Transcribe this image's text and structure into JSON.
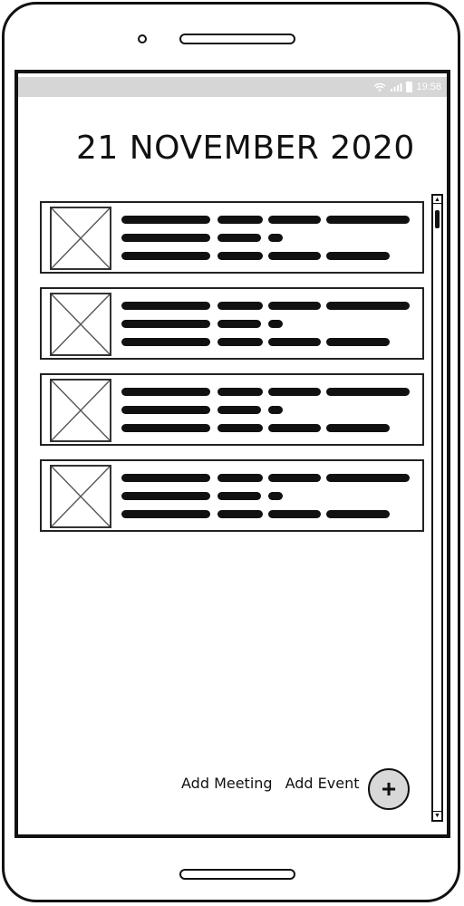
{
  "status_bar": {
    "time": "19:58",
    "wifi_icon": "wifi-icon",
    "signal_icon": "signal-icon",
    "battery_icon": "battery-icon"
  },
  "header": {
    "date_title": "21 NOVEMBER 2020"
  },
  "events": [
    {
      "thumbnail": "image-placeholder-icon",
      "text": "scribbled placeholder text"
    },
    {
      "thumbnail": "image-placeholder-icon",
      "text": "scribbled placeholder text"
    },
    {
      "thumbnail": "image-placeholder-icon",
      "text": "scribbled placeholder text"
    },
    {
      "thumbnail": "image-placeholder-icon",
      "text": "scribbled placeholder text"
    }
  ],
  "actions": {
    "add_meeting": "Add Meeting",
    "add_event": "Add Event",
    "fab_icon": "plus-icon",
    "fab_glyph": "+"
  },
  "colors": {
    "status_bar": "#d6d6d6",
    "fab": "#d8d8d8",
    "ink": "#111111"
  }
}
